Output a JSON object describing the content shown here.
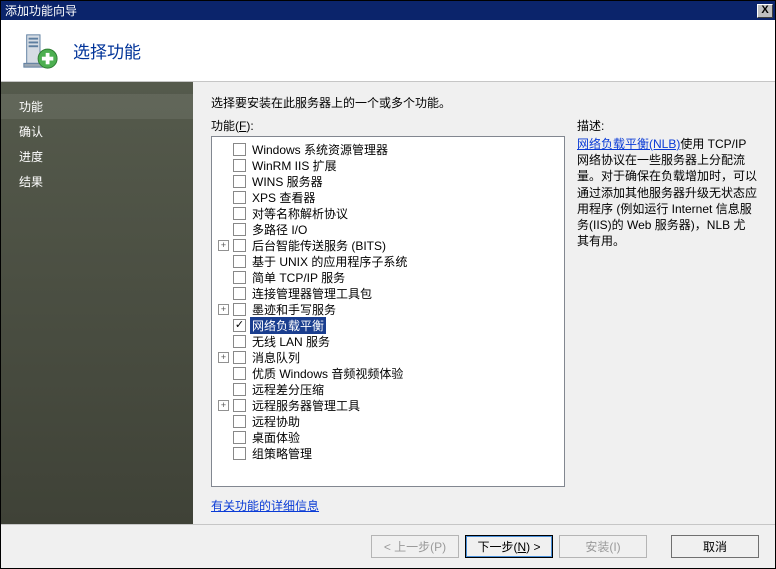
{
  "titlebar": {
    "title": "添加功能向导",
    "close": "X"
  },
  "header": {
    "title": "选择功能"
  },
  "sidebar": {
    "items": [
      {
        "key": "features",
        "label": "功能",
        "active": true
      },
      {
        "key": "confirm",
        "label": "确认"
      },
      {
        "key": "progress",
        "label": "进度"
      },
      {
        "key": "results",
        "label": "结果"
      }
    ]
  },
  "main": {
    "instruction": "选择要安装在此服务器上的一个或多个功能。",
    "features_label_prefix": "功能(",
    "features_label_hotkey": "F",
    "features_label_suffix": "):",
    "desc_label": "描述:",
    "more_link": "有关功能的详细信息"
  },
  "features": [
    {
      "label": "Windows 系统资源管理器"
    },
    {
      "label": "WinRM IIS 扩展"
    },
    {
      "label": "WINS 服务器"
    },
    {
      "label": "XPS 查看器"
    },
    {
      "label": "对等名称解析协议"
    },
    {
      "label": "多路径 I/O"
    },
    {
      "label": "后台智能传送服务 (BITS)",
      "expandable": true
    },
    {
      "label": "基于 UNIX 的应用程序子系统"
    },
    {
      "label": "简单 TCP/IP 服务"
    },
    {
      "label": "连接管理器管理工具包"
    },
    {
      "label": "墨迹和手写服务",
      "expandable": true
    },
    {
      "label": "网络负载平衡",
      "checked": true,
      "selected": true
    },
    {
      "label": "无线 LAN 服务"
    },
    {
      "label": "消息队列",
      "expandable": true
    },
    {
      "label": "优质 Windows 音频视频体验"
    },
    {
      "label": "远程差分压缩"
    },
    {
      "label": "远程服务器管理工具",
      "expandable": true
    },
    {
      "label": "远程协助"
    },
    {
      "label": "桌面体验"
    },
    {
      "label": "组策略管理"
    }
  ],
  "description": {
    "link_text": "网络负载平衡(NLB)",
    "body_rest": "使用 TCP/IP 网络协议在一些服务器上分配流量。对于确保在负载增加时，可以通过添加其他服务器升级无状态应用程序 (例如运行 Internet 信息服务(IIS)的 Web 服务器)，NLB 尤其有用。"
  },
  "footer": {
    "prev": "< 上一步(P)",
    "next_prefix": "下一步(",
    "next_hotkey": "N",
    "next_suffix": ") >",
    "install": "安装(I)",
    "cancel": "取消"
  },
  "icons": {
    "close": "close-icon",
    "server": "server-icon",
    "plus": "plus-badge-icon"
  }
}
